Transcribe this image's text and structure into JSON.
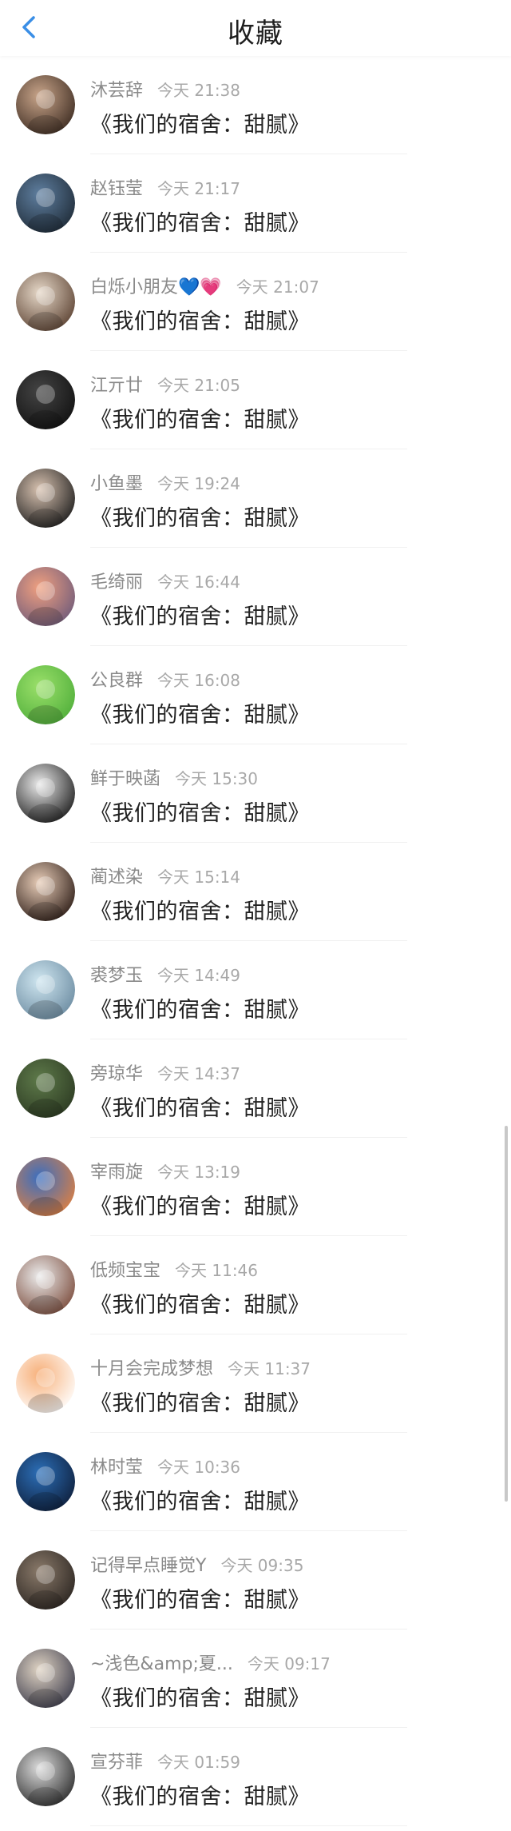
{
  "header": {
    "title": "收藏",
    "back_icon": "chevron-left-icon",
    "back_color": "#3a8ee6"
  },
  "favorites": [
    {
      "name": "沐芸辞",
      "time": "今天 21:38",
      "message": "《我们的宿舍：甜腻》",
      "avatar_colors": [
        "#c9a58a",
        "#3b2a20"
      ]
    },
    {
      "name": "赵钰莹",
      "time": "今天 21:17",
      "message": "《我们的宿舍：甜腻》",
      "avatar_colors": [
        "#5f7fa0",
        "#1e2a36"
      ]
    },
    {
      "name": "白烁小朋友💙💗",
      "time": "今天 21:07",
      "message": "《我们的宿舍：甜腻》",
      "avatar_colors": [
        "#e6d8c8",
        "#5a4030"
      ]
    },
    {
      "name": "江亓廿",
      "time": "今天 21:05",
      "message": "《我们的宿舍：甜腻》",
      "avatar_colors": [
        "#444444",
        "#111111"
      ]
    },
    {
      "name": "小鱼墨",
      "time": "今天 19:24",
      "message": "《我们的宿舍：甜腻》",
      "avatar_colors": [
        "#d8c2b0",
        "#1b1b1b"
      ]
    },
    {
      "name": "毛绮丽",
      "time": "今天 16:44",
      "message": "《我们的宿舍：甜腻》",
      "avatar_colors": [
        "#f0a080",
        "#6e5a7a"
      ]
    },
    {
      "name": "公良群",
      "time": "今天 16:08",
      "message": "《我们的宿舍：甜腻》",
      "avatar_colors": [
        "#9be06a",
        "#4fae3a"
      ]
    },
    {
      "name": "鲜于映菡",
      "time": "今天 15:30",
      "message": "《我们的宿舍：甜腻》",
      "avatar_colors": [
        "#eaeaea",
        "#1a1a1a"
      ]
    },
    {
      "name": "蔺述染",
      "time": "今天 15:14",
      "message": "《我们的宿舍：甜腻》",
      "avatar_colors": [
        "#e8cdb8",
        "#2a1a14"
      ]
    },
    {
      "name": "裘梦玉",
      "time": "今天 14:49",
      "message": "《我们的宿舍：甜腻》",
      "avatar_colors": [
        "#cfe6f0",
        "#6a8aa0"
      ]
    },
    {
      "name": "旁琼华",
      "time": "今天 14:37",
      "message": "《我们的宿舍：甜腻》",
      "avatar_colors": [
        "#5e7a4a",
        "#2c3a22"
      ]
    },
    {
      "name": "宰雨旋",
      "time": "今天 13:19",
      "message": "《我们的宿舍：甜腻》",
      "avatar_colors": [
        "#3a6ec0",
        "#e08040"
      ]
    },
    {
      "name": "低频宝宝",
      "time": "今天 11:46",
      "message": "《我们的宿舍：甜腻》",
      "avatar_colors": [
        "#ececec",
        "#7a4a3a"
      ]
    },
    {
      "name": "十月会完成梦想",
      "time": "今天 11:37",
      "message": "《我们的宿舍：甜腻》",
      "avatar_colors": [
        "#f7b07a",
        "#ffffff"
      ]
    },
    {
      "name": "林时莹",
      "time": "今天 10:36",
      "message": "《我们的宿舍：甜腻》",
      "avatar_colors": [
        "#2c6fb8",
        "#0e1e3a"
      ]
    },
    {
      "name": "记得早点睡觉Y",
      "time": "今天 09:35",
      "message": "《我们的宿舍：甜腻》",
      "avatar_colors": [
        "#8a7a6a",
        "#2a2420"
      ]
    },
    {
      "name": "~浅色&amp;夏...",
      "time": "今天 09:17",
      "message": "《我们的宿舍：甜腻》",
      "avatar_colors": [
        "#e0d4c4",
        "#3a3a4a"
      ]
    },
    {
      "name": "宣芬菲",
      "time": "今天 01:59",
      "message": "《我们的宿舍：甜腻》",
      "avatar_colors": [
        "#dcdcdc",
        "#2a2a2a"
      ]
    }
  ]
}
